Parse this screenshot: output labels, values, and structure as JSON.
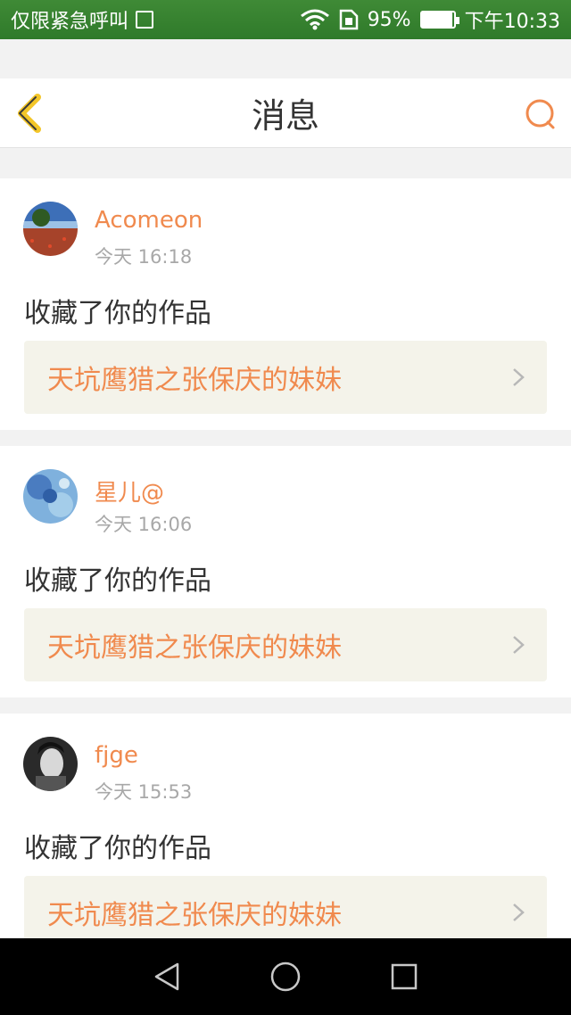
{
  "status_bar": {
    "carrier": "仅限紧急呼叫",
    "battery": "95%",
    "battery_level": 0.95,
    "time": "下午10:33"
  },
  "header": {
    "title": "消息",
    "accent_color": "#f08a4e"
  },
  "messages": [
    {
      "username": "Acomeon",
      "time": "今天 16:18",
      "action": "收藏了你的作品",
      "work_title": "天坑鹰猎之张保庆的妹妹",
      "avatar": "landscape-avatar"
    },
    {
      "username": "星儿@",
      "time": "今天 16:06",
      "action": "收藏了你的作品",
      "work_title": "天坑鹰猎之张保庆的妹妹",
      "avatar": "blue-abstract-avatar"
    },
    {
      "username": "fjge",
      "time": "今天 15:53",
      "action": "收藏了你的作品",
      "work_title": "天坑鹰猎之张保庆的妹妹",
      "avatar": "portrait-avatar"
    }
  ],
  "colors": {
    "status_bar": "#2f7a2a",
    "username": "#f08a4e",
    "link_bg": "#f4f3ea",
    "timestamp": "#a8a8a8"
  }
}
